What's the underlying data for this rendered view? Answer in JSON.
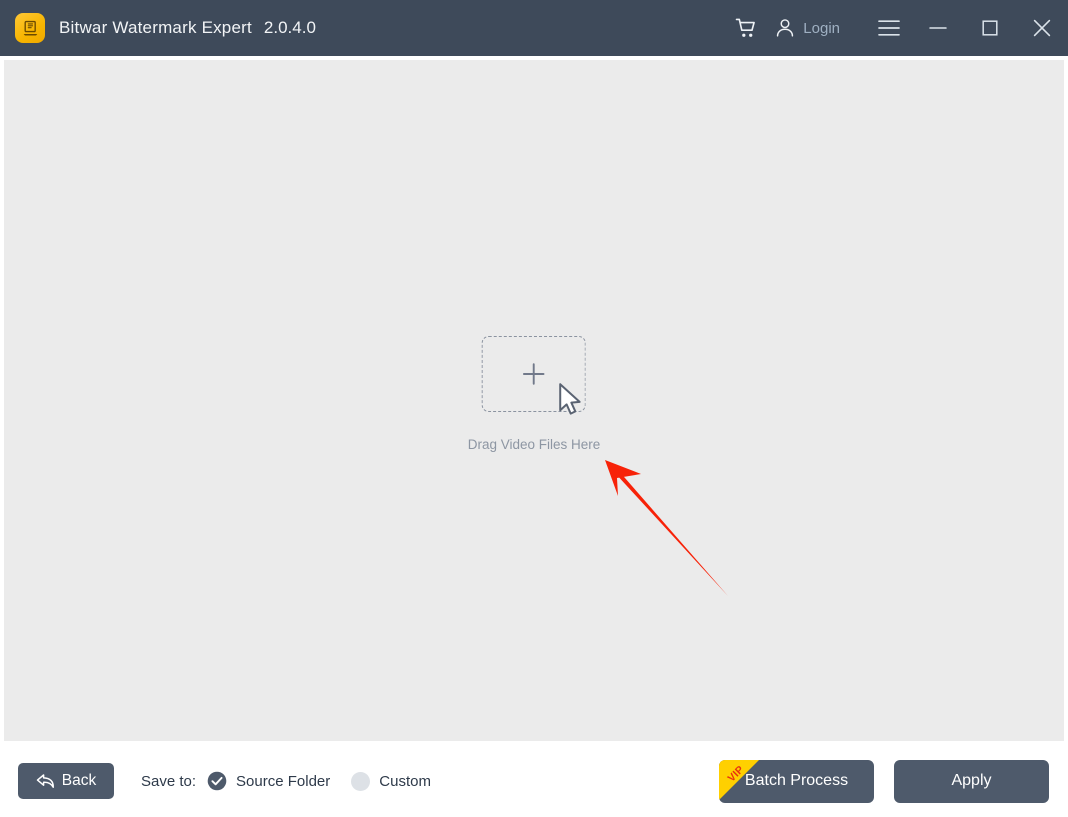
{
  "window": {
    "title": "Bitwar Watermark Expert",
    "version": "2.0.4.0",
    "app_icon": "app-logo-icon",
    "colors": {
      "titlebar_bg": "#3e4a5a",
      "canvas_bg": "#ebebeb",
      "bottombar_bg": "#ffffff",
      "button_bg": "#4e5a6b",
      "accent_yellow": "#ffd000",
      "vip_text": "#e8330f",
      "annotation_red": "#f72208",
      "muted_text": "#8d96a3",
      "login_text": "#9fb0c2"
    }
  },
  "titlebar_controls": {
    "cart": {
      "icon": "shopping-cart-icon",
      "label": ""
    },
    "login": {
      "icon": "user-account-icon",
      "label": "Login"
    },
    "menu": {
      "icon": "hamburger-menu-icon"
    },
    "minimize": {
      "icon": "minimize-icon"
    },
    "maximize": {
      "icon": "maximize-icon"
    },
    "close": {
      "icon": "close-icon"
    }
  },
  "main": {
    "dropzone": {
      "plus_icon": "plus-icon",
      "label": "Drag Video Files Here"
    },
    "cursor": {
      "icon": "mouse-pointer-icon"
    },
    "annotation": {
      "icon": "red-arrow-annotation"
    }
  },
  "bottom": {
    "back": {
      "icon": "back-arrow-icon",
      "label": "Back"
    },
    "save_to_label": "Save to:",
    "save_to_options": [
      {
        "label": "Source Folder",
        "selected": true,
        "icon": "radio-checked-icon"
      },
      {
        "label": "Custom",
        "selected": false,
        "icon": "radio-unchecked-icon"
      }
    ],
    "batch_process": {
      "label": "Batch Process",
      "badge": "VIP"
    },
    "apply": {
      "label": "Apply"
    }
  }
}
